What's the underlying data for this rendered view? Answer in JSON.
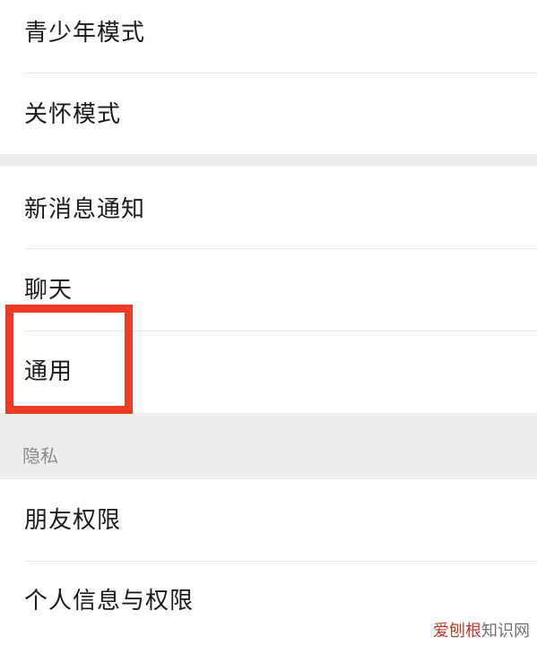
{
  "settings": {
    "items": [
      {
        "label": "青少年模式"
      },
      {
        "label": "关怀模式"
      },
      {
        "label": "新消息通知"
      },
      {
        "label": "聊天"
      },
      {
        "label": "通用"
      },
      {
        "label": "朋友权限"
      },
      {
        "label": "个人信息与权限"
      }
    ],
    "privacy_section_header": "隐私"
  },
  "annotation": {
    "highlight_color": "#ee3b24"
  },
  "watermark": {
    "part_a": "爱刨根",
    "part_b": "知识网"
  },
  "colors": {
    "background": "#ffffff",
    "section_gap": "#ededed",
    "divider": "#e8e8e8",
    "text": "#1a1a1a",
    "section_header_text": "#8a8a8a"
  }
}
